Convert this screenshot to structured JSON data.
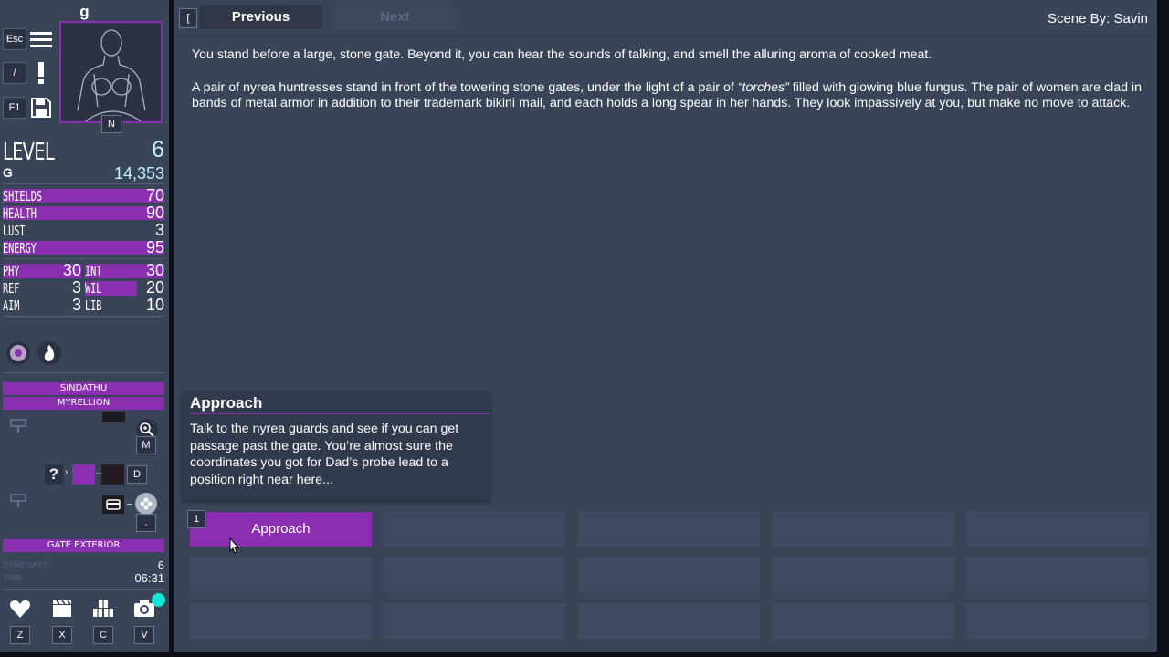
{
  "player": {
    "name": "g",
    "portrait_key": "N",
    "level_label": "LEVEL",
    "level": "6",
    "credits_symbol": "G",
    "credits": "14,353"
  },
  "menu_keys": {
    "esc": "Esc",
    "slash": "/",
    "f1": "F1",
    "top_key": "["
  },
  "stats": [
    {
      "label": "SHIELDS",
      "value": "70",
      "fill": 1.0
    },
    {
      "label": "HEALTH",
      "value": "90",
      "fill": 1.0
    },
    {
      "label": "LUST",
      "value": "3",
      "fill": 0.0
    },
    {
      "label": "ENERGY",
      "value": "95",
      "fill": 1.0
    }
  ],
  "attributes": [
    {
      "label": "PHY",
      "value": "30",
      "fill": 1.0
    },
    {
      "label": "INT",
      "value": "30",
      "fill": 1.0
    },
    {
      "label": "REF",
      "value": "3",
      "fill": 0.0
    },
    {
      "label": "WIL",
      "value": "20",
      "fill": 0.66
    },
    {
      "label": "AIM",
      "value": "3",
      "fill": 0.0
    },
    {
      "label": "LIB",
      "value": "10",
      "fill": 0.0
    }
  ],
  "location": {
    "system": "SINDATHU",
    "planet": "MYRELLION",
    "room": "GATE EXTERIOR",
    "map_keys": {
      "m": "M",
      "d": "D",
      "dot": ".",
      "question": "?"
    }
  },
  "time": {
    "days_label": "STAR DAYS",
    "days": "6",
    "time_label": "TIME",
    "time": "06:31"
  },
  "bottom_keys": [
    "Z",
    "X",
    "C",
    "V"
  ],
  "nav": {
    "previous": "Previous",
    "next": "Next",
    "scene_by": "Scene By: Savin"
  },
  "story": {
    "p1": "You stand before a large, stone gate. Beyond it, you can hear the sounds of talking, and smell the alluring aroma of cooked meat.",
    "p2_a": "A pair of nyrea huntresses stand in front of the towering stone gates, under the light of a pair of ",
    "p2_em": "“torches”",
    "p2_b": " filled with glowing blue fungus. The pair of women are clad in bands of metal armor in addition to their trademark bikini mail, and each holds a long spear in her hands. They look impassively at you, but make no move to attack."
  },
  "tooltip": {
    "title": "Approach",
    "body": "Talk to the nyrea guards and see if you can get passage past the gate. You’re almost sure the coordinates you got for Dad’s probe lead to a position right near here..."
  },
  "choices": [
    {
      "key": "1",
      "label": "Approach"
    }
  ],
  "colors": {
    "accent": "#8a2fb0",
    "panel": "#3a4458",
    "value_cyan": "#bff4ff",
    "notify": "#17e6d6"
  }
}
